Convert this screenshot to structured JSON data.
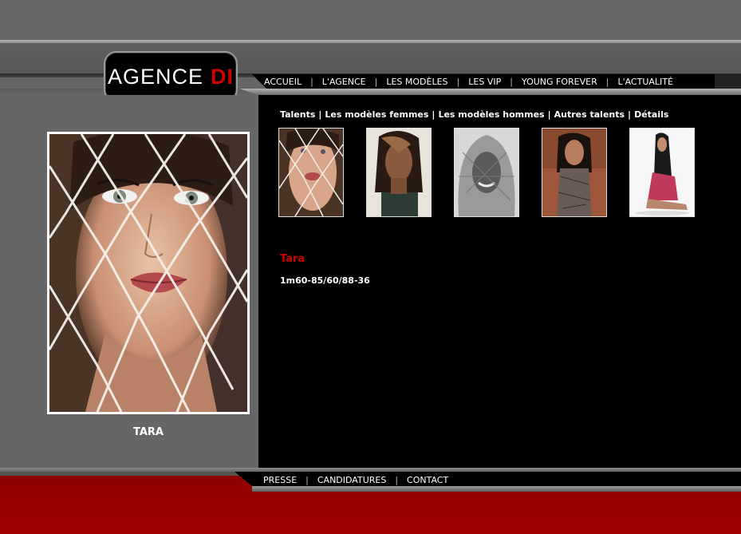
{
  "logo": {
    "text": "AGENCE",
    "accent": "DI",
    "accent_color": "#d00000"
  },
  "top_nav": [
    {
      "label": "ACCUEIL"
    },
    {
      "label": "L'AGENCE"
    },
    {
      "label": "LES MODÈLES"
    },
    {
      "label": "LES VIP"
    },
    {
      "label": "YOUNG FOREVER"
    },
    {
      "label": "L'ACTUALITÉ"
    }
  ],
  "separator": "|",
  "sub_nav": [
    {
      "label": "Talents"
    },
    {
      "label": "Les modèles femmes"
    },
    {
      "label": "Les modèles hommes"
    },
    {
      "label": "Autres talents"
    },
    {
      "label": "Détails"
    }
  ],
  "main_photo": {
    "caption": "TARA"
  },
  "thumbnails": [
    {
      "name": "thumb-net-portrait"
    },
    {
      "name": "thumb-dark-hair"
    },
    {
      "name": "thumb-headscarf"
    },
    {
      "name": "thumb-patterned-top"
    },
    {
      "name": "thumb-seated-pink"
    }
  ],
  "model": {
    "name": "Tara",
    "measurements": "1m60-85/60/88-36"
  },
  "footer_nav": [
    {
      "label": "PRESSE"
    },
    {
      "label": "CANDIDATURES"
    },
    {
      "label": "CONTACT"
    }
  ],
  "colors": {
    "background": "#666666",
    "panel": "#000000",
    "accent_red": "#cc0000",
    "footer_red": "#9a0000"
  }
}
